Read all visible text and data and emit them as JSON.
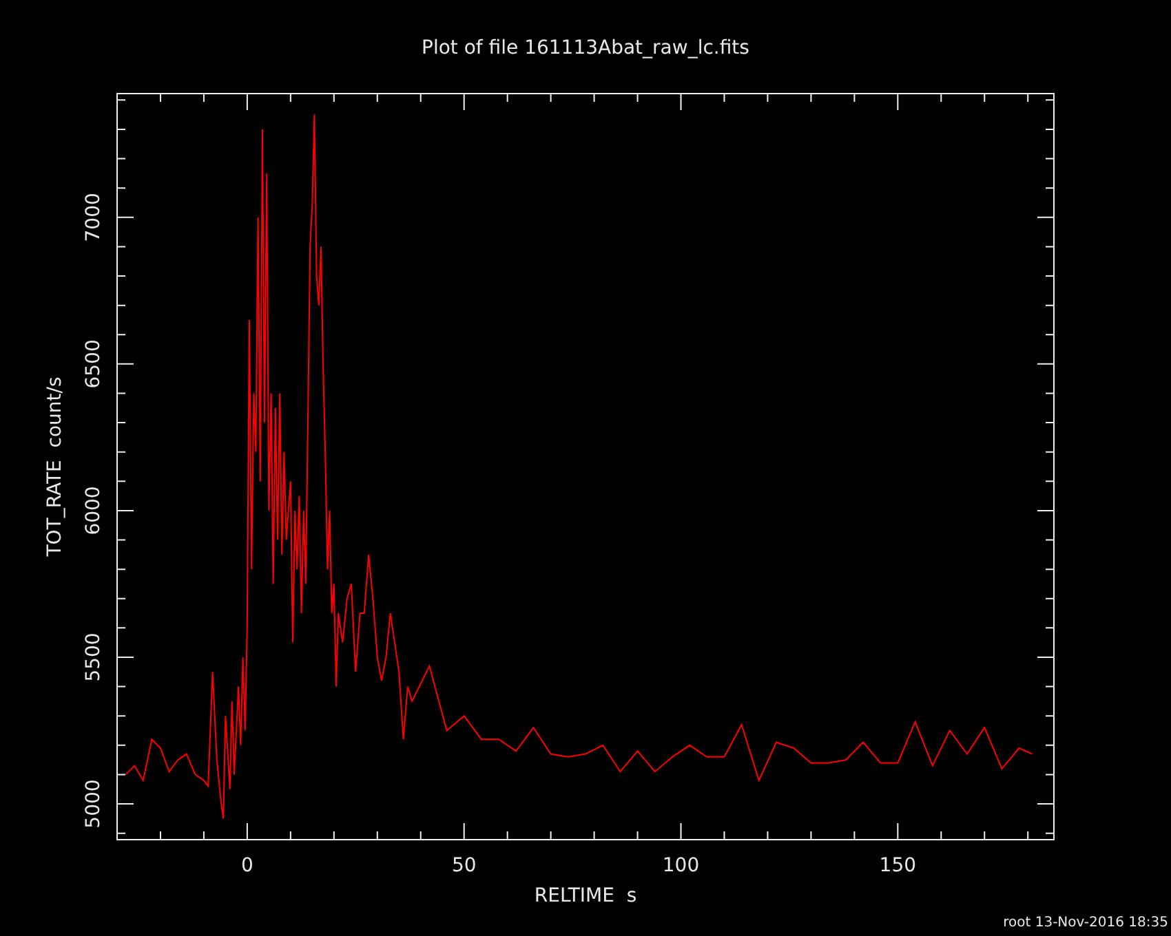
{
  "chart_data": {
    "type": "line",
    "title": "Plot of file 161113Abat_raw_lc.fits",
    "xlabel": "RELTIME  s",
    "ylabel": "TOT_RATE  count/s",
    "xlim": [
      -30,
      186
    ],
    "ylim": [
      4878,
      7422
    ],
    "xticks": [
      0,
      50,
      100,
      150
    ],
    "yticks": [
      5000,
      5500,
      6000,
      6500,
      7000
    ],
    "x": [
      -28,
      -26,
      -24,
      -22,
      -20,
      -18,
      -16,
      -14,
      -12,
      -10,
      -9,
      -8,
      -7,
      -6,
      -5.5,
      -5,
      -4,
      -3.5,
      -3,
      -2,
      -1.5,
      -1,
      -0.5,
      0,
      0.5,
      1,
      1.5,
      2,
      2.5,
      3,
      3.5,
      4,
      4.5,
      5,
      5.5,
      6,
      6.5,
      7,
      7.5,
      8,
      8.5,
      9,
      10,
      10.5,
      11,
      11.5,
      12,
      12.5,
      13,
      13.5,
      14,
      14.5,
      15,
      15.5,
      16,
      16.5,
      17,
      17.5,
      18,
      18.5,
      19,
      19.5,
      20,
      20.5,
      21,
      22,
      23,
      24,
      25,
      26,
      27,
      28,
      29,
      30,
      31,
      32,
      33,
      34,
      35,
      36,
      37,
      38,
      42,
      46,
      50,
      54,
      58,
      62,
      66,
      70,
      74,
      78,
      82,
      86,
      90,
      94,
      98,
      102,
      106,
      110,
      114,
      118,
      122,
      126,
      130,
      134,
      138,
      142,
      146,
      150,
      154,
      158,
      162,
      166,
      170,
      174,
      178,
      181
    ],
    "series": [
      {
        "color": "#ff0000",
        "values": [
          5100,
          5130,
          5080,
          5220,
          5190,
          5110,
          5150,
          5170,
          5100,
          5080,
          5060,
          5450,
          5150,
          5000,
          4950,
          5300,
          5050,
          5350,
          5100,
          5400,
          5200,
          5500,
          5250,
          5600,
          6650,
          5800,
          6400,
          6200,
          7000,
          6100,
          7300,
          6300,
          7150,
          6000,
          6400,
          5750,
          6350,
          5900,
          6400,
          5850,
          6200,
          5900,
          6100,
          5550,
          6000,
          5800,
          6050,
          5650,
          6000,
          5750,
          6300,
          6900,
          7050,
          7350,
          6800,
          6700,
          6900,
          6500,
          6200,
          5800,
          6000,
          5650,
          5750,
          5400,
          5650,
          5550,
          5700,
          5750,
          5450,
          5650,
          5650,
          5850,
          5700,
          5500,
          5420,
          5500,
          5650,
          5550,
          5450,
          5220,
          5400,
          5350,
          5470,
          5250,
          5300,
          5220,
          5220,
          5180,
          5260,
          5170,
          5160,
          5170,
          5200,
          5110,
          5180,
          5110,
          5160,
          5200,
          5160,
          5160,
          5270,
          5080,
          5210,
          5190,
          5140,
          5140,
          5150,
          5210,
          5140,
          5140,
          5280,
          5130,
          5250,
          5170,
          5260,
          5120,
          5190,
          5170
        ]
      }
    ]
  },
  "footer": "root 13-Nov-2016 18:35"
}
